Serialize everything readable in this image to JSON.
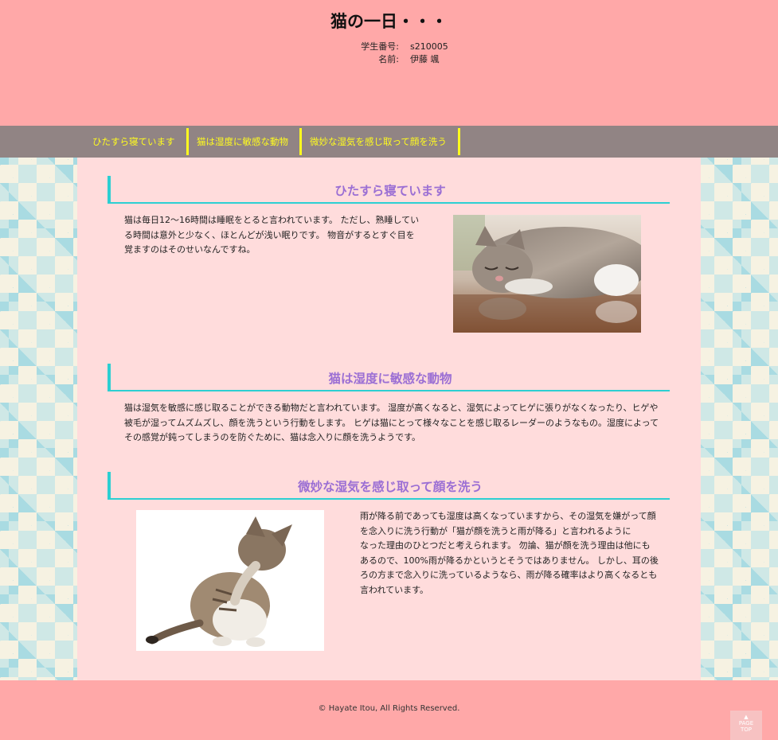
{
  "header": {
    "title": "猫の一日・・・",
    "student_id_label": "学生番号:",
    "student_id": "s210005",
    "name_label": "名前:",
    "name": "伊藤 颯"
  },
  "nav": {
    "items": [
      {
        "label": "ひたすら寝ています"
      },
      {
        "label": "猫は湿度に敏感な動物"
      },
      {
        "label": "微妙な湿気を感じ取って顔を洗う"
      }
    ]
  },
  "sections": [
    {
      "heading": "ひたすら寝ています",
      "lines": [
        "猫は毎日12〜16時間は睡眠をとると言われています。 ただし、熟睡してい",
        "る時間は意外と少なく、ほとんどが浅い眠りです。 物音がするとすぐ目を",
        "覚ますのはそのせいなんですね。"
      ]
    },
    {
      "heading": "猫は湿度に敏感な動物",
      "lines": [
        "猫は湿気を敏感に感じ取ることができる動物だと言われています。 湿度が高くなると、湿気によってヒゲに張りがなくなったり、ヒゲや",
        "被毛が湿ってムズムズし、顔を洗うという行動をします。 ヒゲは猫にとって様々なことを感じ取るレーダーのようなもの。湿度によって",
        "その感覚が鈍ってしまうのを防ぐために、猫は念入りに顔を洗うようです。"
      ]
    },
    {
      "heading": "微妙な湿気を感じ取って顔を洗う",
      "lines": [
        "雨が降る前であっても湿度は高くなっていますから、その湿気を嫌がって顔",
        "を念入りに洗う行動が「猫が顔を洗うと雨が降る」と言われるように",
        "なった理由のひとつだと考えられます。 勿論、猫が顔を洗う理由は他にも",
        "あるので、100%雨が降るかというとそうではありません。 しかし、耳の後",
        "ろの方まで念入りに洗っているようなら、雨が降る確率はより高くなるとも",
        "言われています。"
      ]
    }
  ],
  "footer": {
    "copyright": "© Hayate Itou, All Rights Reserved.",
    "pagetop_arrow": "▲",
    "pagetop_line1": "PAGE",
    "pagetop_line2": "TOP"
  },
  "colors": {
    "header_bg": "#ffa8a8",
    "nav_bg": "#918484",
    "nav_text": "#fffb1f",
    "content_bg": "#ffdcdc",
    "heading_text": "#9b6fd4",
    "heading_border": "#2ccfd2"
  }
}
